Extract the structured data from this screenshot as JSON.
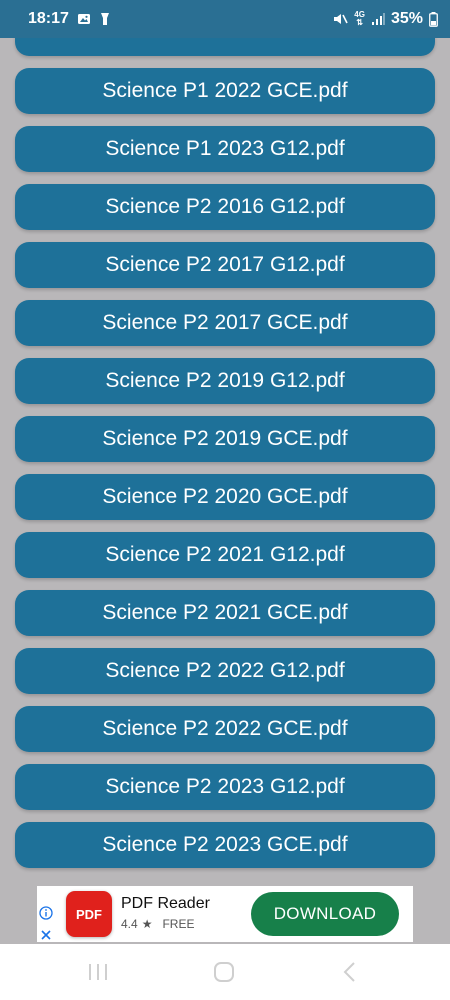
{
  "status_bar": {
    "time": "18:17",
    "network": "4G",
    "battery": "35%",
    "icons": [
      "gallery-icon",
      "flashlight-icon",
      "mute-icon",
      "signal-icon",
      "battery-icon"
    ]
  },
  "file_list": {
    "items": [
      "",
      "Science P1 2022 GCE.pdf",
      "Science P1 2023 G12.pdf",
      "Science P2 2016 G12.pdf",
      "Science P2 2017 G12.pdf",
      "Science P2 2017 GCE.pdf",
      "Science P2 2019 G12.pdf",
      "Science P2 2019 GCE.pdf",
      "Science P2 2020 GCE.pdf",
      "Science P2 2021 G12.pdf",
      "Science P2 2021 GCE.pdf",
      "Science P2 2022 G12.pdf",
      "Science P2 2022 GCE.pdf",
      "Science P2 2023 G12.pdf",
      "Science P2 2023 GCE.pdf"
    ]
  },
  "ad": {
    "logo_text": "PDF",
    "app_name": "PDF Reader",
    "rating": "4.4",
    "price": "FREE",
    "button_label": "DOWNLOAD"
  },
  "colors": {
    "status_bar": "#2a6f93",
    "background": "#b9b7b9",
    "button": "#1e7199",
    "download": "#17804a",
    "pdf_logo": "#e0211c"
  }
}
